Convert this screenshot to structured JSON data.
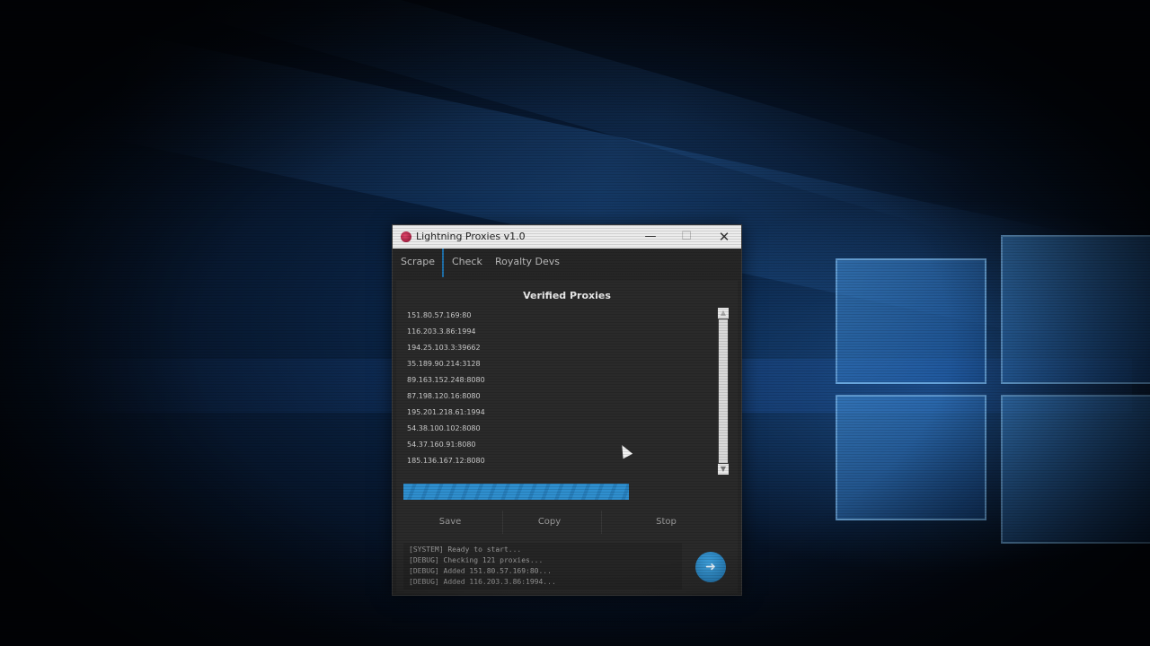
{
  "window": {
    "title": "Lightning Proxies v1.0",
    "minimize_glyph": "—",
    "maximize_glyph": "☐",
    "close_glyph": "✕"
  },
  "tabs": [
    {
      "label": "Scrape"
    },
    {
      "label": "Check"
    },
    {
      "label": "Royalty Devs"
    }
  ],
  "active_tab": "Check",
  "panel": {
    "title": "Verified Proxies",
    "proxies": [
      "151.80.57.169:80",
      "116.203.3.86:1994",
      "194.25.103.3:39662",
      "35.189.90.214:3128",
      "89.163.152.248:8080",
      "87.198.120.16:8080",
      "195.201.218.61:1994",
      "54.38.100.102:8080",
      "54.37.160.91:8080",
      "185.136.167.12:8080"
    ]
  },
  "progress": {
    "fraction": 0.69
  },
  "actions": {
    "save_label": "Save",
    "copy_label": "Copy",
    "stop_label": "Stop"
  },
  "console": {
    "lines": [
      "[SYSTEM] Ready to start...",
      "[DEBUG] Checking 121 proxies...",
      "[DEBUG] Added 151.80.57.169:80...",
      "[DEBUG] Added 116.203.3.86:1994..."
    ]
  },
  "icons": {
    "app": "lightning-app-icon",
    "run": "arrow-right-icon",
    "scroll_up": "chevron-up-icon",
    "scroll_down": "chevron-down-icon"
  },
  "colors": {
    "accent": "#2f8fcf",
    "window_bg": "#262626",
    "titlebar_bg": "#ececec"
  },
  "glyphs": {
    "run": "➜",
    "scroll_up": "▲",
    "scroll_down": "▼"
  }
}
